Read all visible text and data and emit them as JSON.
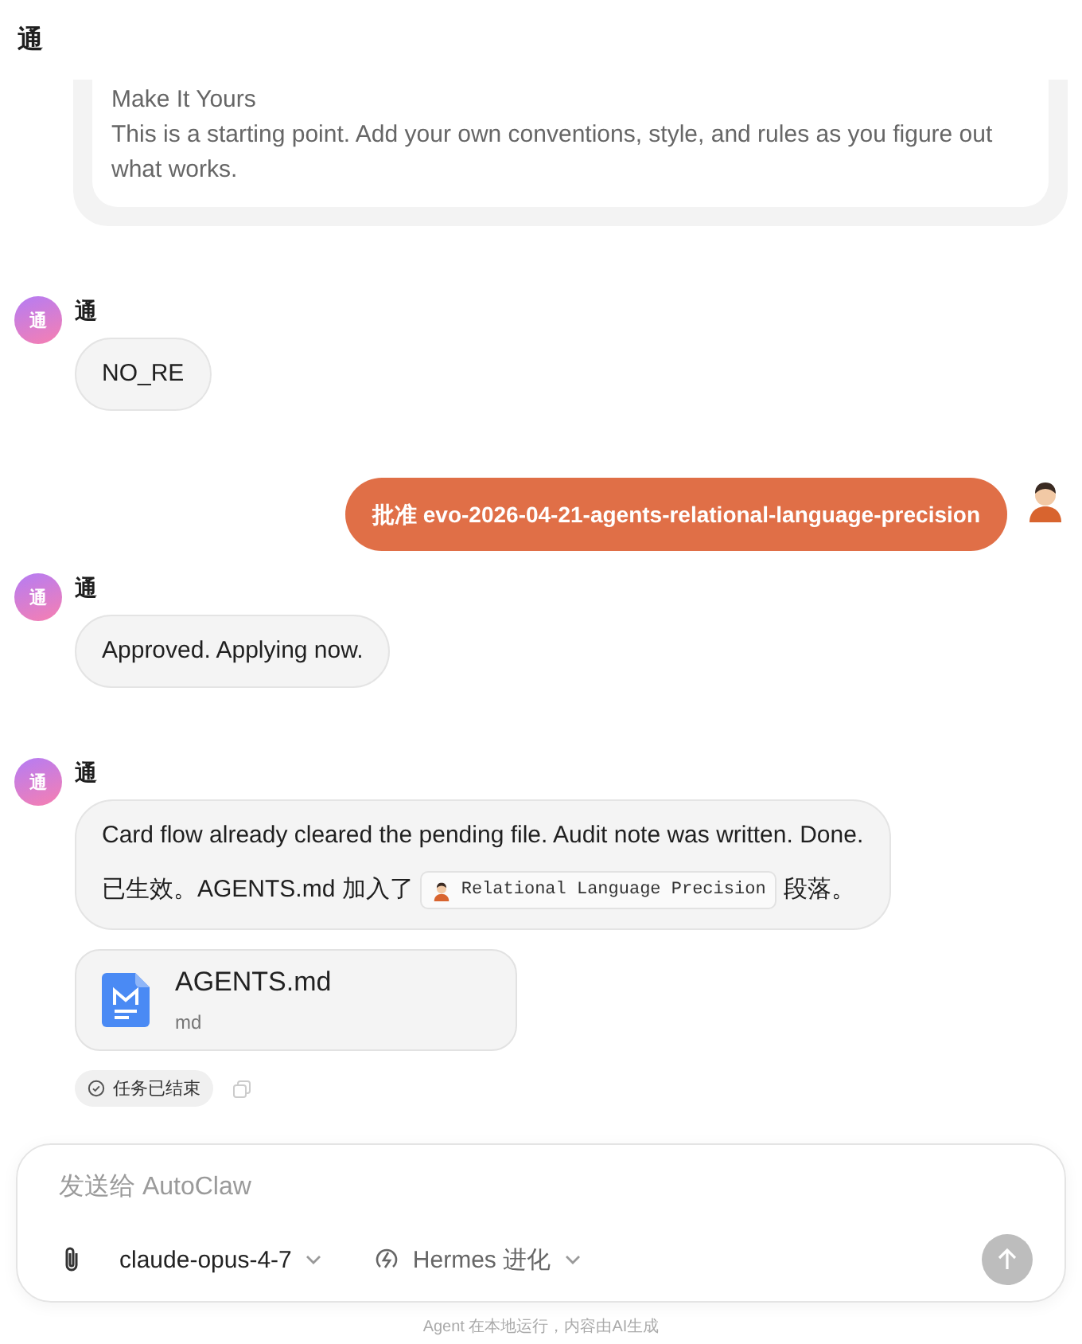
{
  "header": {
    "title": "通"
  },
  "messages": [
    {
      "kind": "card",
      "title": "Make It Yours",
      "body": "This is a starting point. Add your own conventions, style, and rules as you figure out what works."
    },
    {
      "kind": "agent",
      "avatar": "通",
      "name": "通",
      "paragraphs": [
        {
          "text": "NO_RE"
        }
      ]
    },
    {
      "kind": "user",
      "text": "批准 evo-2026-04-21-agents-relational-language-precision"
    },
    {
      "kind": "agent",
      "avatar": "通",
      "name": "通",
      "paragraphs": [
        {
          "text": "Approved. Applying now."
        }
      ]
    },
    {
      "kind": "agent",
      "avatar": "通",
      "name": "通",
      "paragraphs": [
        {
          "text": "Card flow already cleared the pending file. Audit note was written. Done."
        },
        {
          "text": "已生效。AGENTS.md 加入了",
          "code": "Relational Language Precision",
          "after": "段落。"
        }
      ],
      "attachment": {
        "name": "AGENTS.md",
        "type": "md"
      },
      "status": {
        "label": "任务已结束"
      }
    }
  ],
  "composer": {
    "placeholder": "发送给 AutoClaw",
    "model": "claude-opus-4-7",
    "mode": "Hermes 进化",
    "send_disabled": true
  },
  "footer": "Agent 在本地运行，内容由AI生成"
}
